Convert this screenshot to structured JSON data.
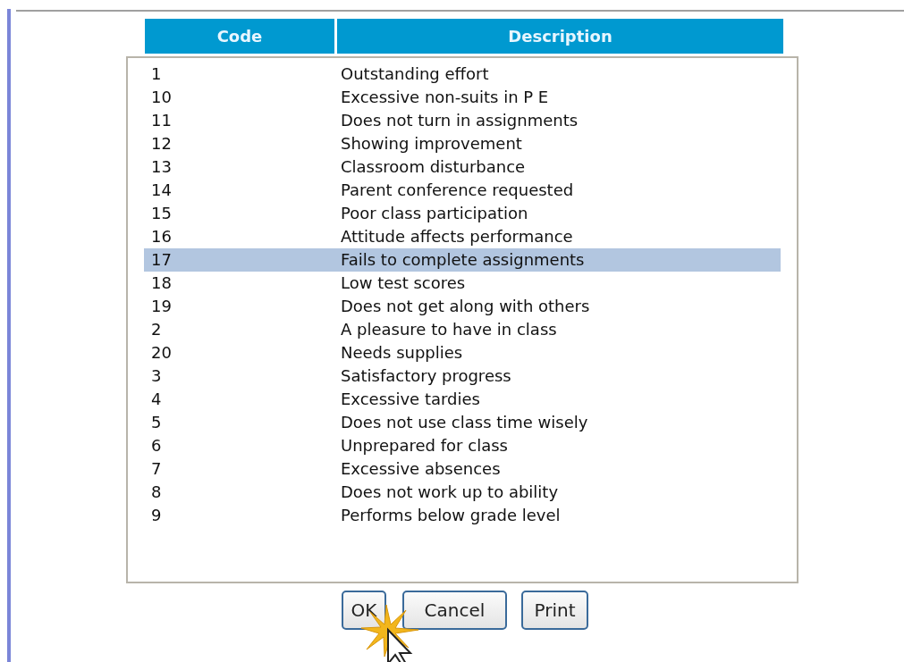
{
  "table": {
    "columns": [
      "Code",
      "Description"
    ],
    "rows": [
      {
        "code": "1",
        "description": "Outstanding effort",
        "selected": false
      },
      {
        "code": "10",
        "description": "Excessive non-suits in P E",
        "selected": false
      },
      {
        "code": "11",
        "description": "Does not turn in assignments",
        "selected": false
      },
      {
        "code": "12",
        "description": "Showing improvement",
        "selected": false
      },
      {
        "code": "13",
        "description": "Classroom disturbance",
        "selected": false
      },
      {
        "code": "14",
        "description": "Parent conference requested",
        "selected": false
      },
      {
        "code": "15",
        "description": "Poor class participation",
        "selected": false
      },
      {
        "code": "16",
        "description": "Attitude affects performance",
        "selected": false
      },
      {
        "code": "17",
        "description": "Fails to complete assignments",
        "selected": true
      },
      {
        "code": "18",
        "description": "Low test scores",
        "selected": false
      },
      {
        "code": "19",
        "description": "Does not get along with others",
        "selected": false
      },
      {
        "code": "2",
        "description": "A pleasure to have in class",
        "selected": false
      },
      {
        "code": "20",
        "description": "Needs supplies",
        "selected": false
      },
      {
        "code": "3",
        "description": "Satisfactory progress",
        "selected": false
      },
      {
        "code": "4",
        "description": "Excessive tardies",
        "selected": false
      },
      {
        "code": "5",
        "description": "Does not use class time wisely",
        "selected": false
      },
      {
        "code": "6",
        "description": "Unprepared for class",
        "selected": false
      },
      {
        "code": "7",
        "description": "Excessive absences",
        "selected": false
      },
      {
        "code": "8",
        "description": "Does not work up to ability",
        "selected": false
      },
      {
        "code": "9",
        "description": "Performs below grade level",
        "selected": false
      }
    ]
  },
  "buttons": [
    "OK",
    "Cancel",
    "Print"
  ]
}
